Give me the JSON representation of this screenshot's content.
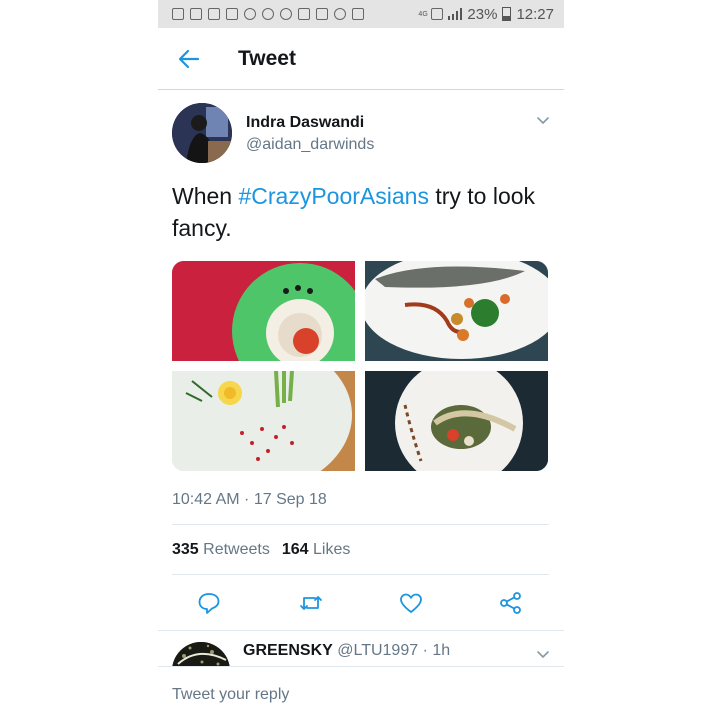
{
  "status_bar": {
    "battery": "23%",
    "time": "12:27",
    "network": "4G"
  },
  "header": {
    "title": "Tweet",
    "back_icon": "arrow-left-icon"
  },
  "tweet": {
    "author_name": "Indra Daswandi",
    "author_handle": "@aidan_darwinds",
    "text_before": "When ",
    "hashtag": "#CrazyPoorAsians",
    "text_after": " try to look fancy.",
    "timestamp": "10:42 AM · 17 Sep 18",
    "retweets_count": "335",
    "retweets_label": "Retweets",
    "likes_count": "164",
    "likes_label": "Likes",
    "photos": [
      "food-photo-1",
      "food-photo-2",
      "food-photo-3",
      "food-photo-4"
    ]
  },
  "actions": [
    "reply-icon",
    "retweet-icon",
    "heart-icon",
    "share-icon"
  ],
  "reply_preview": {
    "name": "GREENSKY",
    "handle_time": "@LTU1997 · 1h"
  },
  "reply_box": {
    "placeholder": "Tweet your reply"
  },
  "colors": {
    "accent": "#1b95e0",
    "secondary_text": "#657786",
    "primary_text": "#14171a"
  }
}
